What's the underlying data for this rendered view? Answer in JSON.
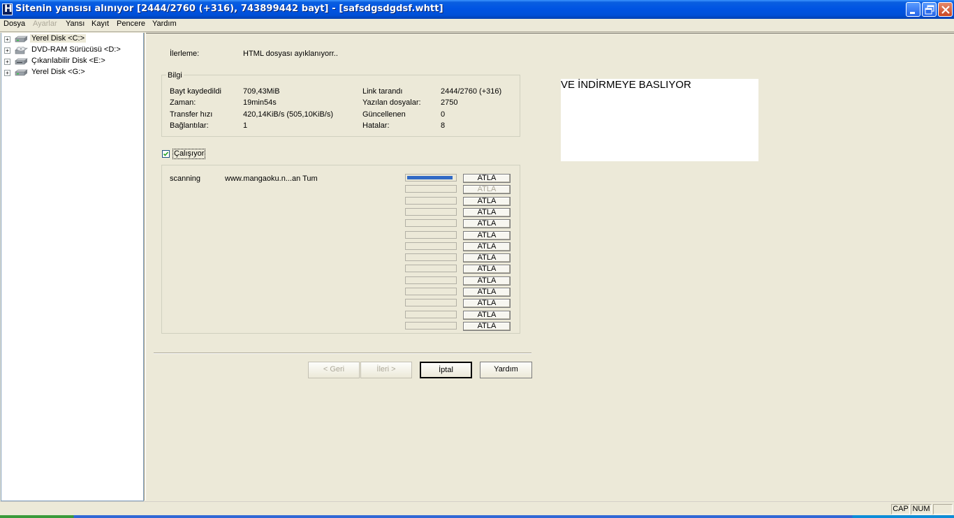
{
  "window": {
    "title": "Sitenin yansısı alınıyor [2444/2760 (+316), 743899442 bayt] - [safsdgsdgdsf.whtt]",
    "app_icon_letter": "H"
  },
  "menu": {
    "items": [
      "Dosya",
      "Ayarlar",
      "Yansı",
      "Kayıt",
      "Pencere",
      "Yardım"
    ],
    "disabled": [
      "Ayarlar"
    ]
  },
  "tree": {
    "items": [
      {
        "label": "Yerel Disk <C:>",
        "icon": "hard-disk-icon",
        "selected": true
      },
      {
        "label": "DVD-RAM Sürücüsü <D:>",
        "icon": "dvd-drive-icon"
      },
      {
        "label": "Çıkarılabilir Disk <E:>",
        "icon": "removable-disk-icon"
      },
      {
        "label": "Yerel Disk <G:>",
        "icon": "hard-disk-icon"
      }
    ]
  },
  "progress": {
    "label": "İlerleme:",
    "value": "HTML dosyası ayıklanıyorr.."
  },
  "info": {
    "group_title": "Bilgi",
    "left": [
      {
        "label": "Bayt kaydedildi",
        "value": "709,43MiB"
      },
      {
        "label": "Zaman:",
        "value": "19min54s"
      },
      {
        "label": "Transfer hızı",
        "value": "420,14KiB/s (505,10KiB/s)"
      },
      {
        "label": "Bağlantılar:",
        "value": "1"
      }
    ],
    "right": [
      {
        "label": "Link tarandı",
        "value": "2444/2760 (+316)"
      },
      {
        "label": "Yazılan dosyalar:",
        "value": "2750"
      },
      {
        "label": "Güncellenen",
        "value": "0"
      },
      {
        "label": "Hatalar:",
        "value": "8"
      }
    ]
  },
  "running": {
    "label": "Çalışıyor",
    "checked": true
  },
  "slots": {
    "first": {
      "status": "scanning",
      "url": "www.mangaoku.n...an Tum",
      "progress": 0.95
    },
    "skip_label": "ATLA",
    "count": 14
  },
  "buttons": {
    "back": "< Geri",
    "next": "İleri >",
    "cancel": "İptal",
    "help": "Yardım"
  },
  "side_note": "VE İNDİRMEYE BASLIYOR",
  "status_bar": {
    "cap": "CAP",
    "num": "NUM"
  },
  "colors": {
    "title_bar": "#0054e3",
    "progress_fill": "#316ac5",
    "close_button": "#c94622"
  }
}
